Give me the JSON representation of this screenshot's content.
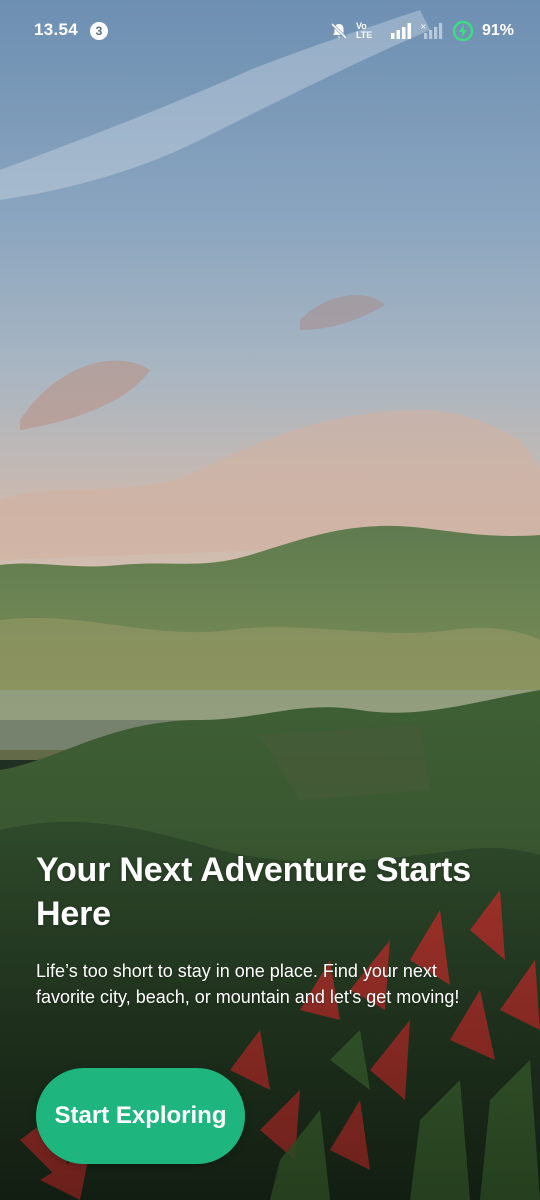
{
  "status_bar": {
    "time": "13.54",
    "notification_count": "3",
    "volte_label": "Vo LTE",
    "battery_percent": "91%",
    "icons": [
      "mute-bell-icon",
      "volte-icon",
      "signal-icon",
      "signal-no-data-icon",
      "battery-charging-icon"
    ]
  },
  "onboarding": {
    "headline": "Your Next Adventure Starts Here",
    "subtext": "Life’s too short to stay in one place. Find your next favorite city, beach, or mountain and let's get moving!",
    "cta_label": "Start Exploring"
  },
  "colors": {
    "accent": "#1fb57e",
    "text": "#ffffff",
    "battery_ring": "#3ddc84"
  }
}
